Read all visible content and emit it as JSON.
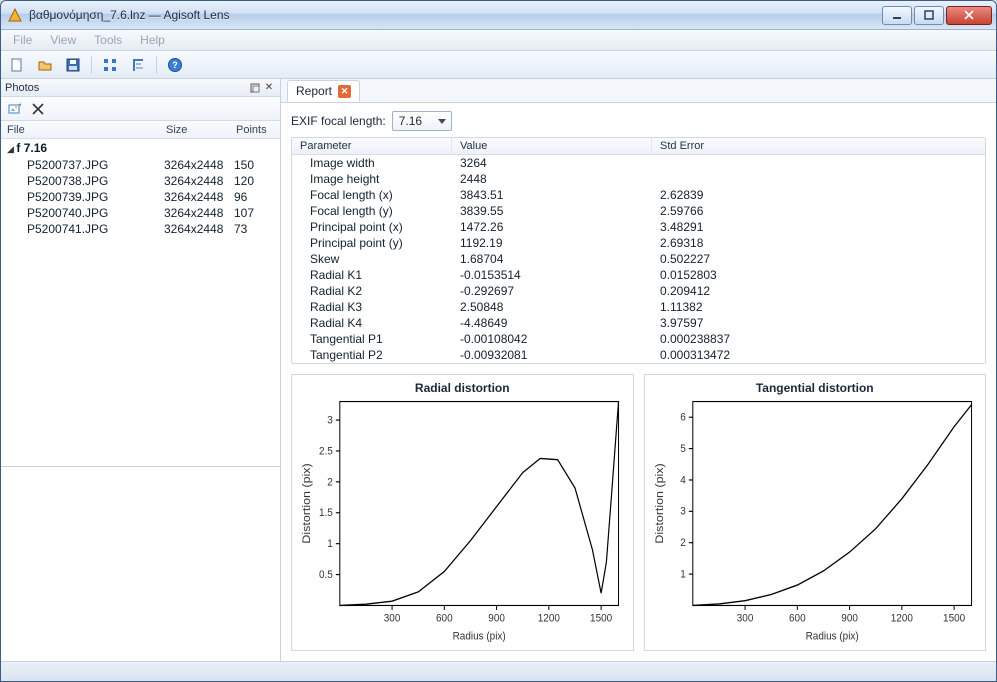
{
  "window": {
    "title": "βαθμονόμηση_7.6.lnz — Agisoft Lens"
  },
  "menu": {
    "file": "File",
    "view": "View",
    "tools": "Tools",
    "help": "Help"
  },
  "photos_panel": {
    "title": "Photos",
    "columns": {
      "file": "File",
      "size": "Size",
      "points": "Points"
    },
    "group_label": "f 7.16",
    "rows": [
      {
        "file": "P5200737.JPG",
        "size": "3264x2448",
        "points": "150"
      },
      {
        "file": "P5200738.JPG",
        "size": "3264x2448",
        "points": "120"
      },
      {
        "file": "P5200739.JPG",
        "size": "3264x2448",
        "points": "96"
      },
      {
        "file": "P5200740.JPG",
        "size": "3264x2448",
        "points": "107"
      },
      {
        "file": "P5200741.JPG",
        "size": "3264x2448",
        "points": "73"
      }
    ]
  },
  "report": {
    "tab_label": "Report",
    "focal_label": "EXIF focal length:",
    "focal_value": "7.16",
    "columns": {
      "parameter": "Parameter",
      "value": "Value",
      "stderr": "Std Error"
    },
    "rows": [
      {
        "param": "Image width",
        "value": "3264",
        "err": ""
      },
      {
        "param": "Image height",
        "value": "2448",
        "err": ""
      },
      {
        "param": "Focal length (x)",
        "value": "3843.51",
        "err": "2.62839"
      },
      {
        "param": "Focal length (y)",
        "value": "3839.55",
        "err": "2.59766"
      },
      {
        "param": "Principal point (x)",
        "value": "1472.26",
        "err": "3.48291"
      },
      {
        "param": "Principal point (y)",
        "value": "1192.19",
        "err": "2.69318"
      },
      {
        "param": "Skew",
        "value": "1.68704",
        "err": "0.502227"
      },
      {
        "param": "Radial K1",
        "value": "-0.0153514",
        "err": "0.0152803"
      },
      {
        "param": "Radial K2",
        "value": "-0.292697",
        "err": "0.209412"
      },
      {
        "param": "Radial K3",
        "value": "2.50848",
        "err": "1.11382"
      },
      {
        "param": "Radial K4",
        "value": "-4.48649",
        "err": "3.97597"
      },
      {
        "param": "Tangential P1",
        "value": "-0.00108042",
        "err": "0.000238837"
      },
      {
        "param": "Tangential P2",
        "value": "-0.00932081",
        "err": "0.000313472"
      }
    ]
  },
  "chart_data": [
    {
      "type": "line",
      "title": "Radial distortion",
      "xlabel": "Radius (pix)",
      "ylabel": "Distortion (pix)",
      "xlim": [
        0,
        1600
      ],
      "ylim": [
        0,
        3.3
      ],
      "xticks": [
        300,
        600,
        900,
        1200,
        1500
      ],
      "yticks": [
        0.5,
        1,
        1.5,
        2,
        2.5,
        3
      ],
      "series": [
        {
          "name": "radial",
          "x": [
            0,
            150,
            300,
            450,
            600,
            750,
            900,
            1050,
            1150,
            1250,
            1350,
            1450,
            1500,
            1530,
            1560,
            1600
          ],
          "values": [
            0.0,
            0.02,
            0.07,
            0.22,
            0.55,
            1.05,
            1.6,
            2.15,
            2.38,
            2.36,
            1.9,
            0.9,
            0.2,
            0.7,
            1.8,
            3.3
          ]
        }
      ]
    },
    {
      "type": "line",
      "title": "Tangential distortion",
      "xlabel": "Radius (pix)",
      "ylabel": "Distortion (pix)",
      "xlim": [
        0,
        1600
      ],
      "ylim": [
        0,
        6.5
      ],
      "xticks": [
        300,
        600,
        900,
        1200,
        1500
      ],
      "yticks": [
        1,
        2,
        3,
        4,
        5,
        6
      ],
      "series": [
        {
          "name": "tangential",
          "x": [
            0,
            150,
            300,
            450,
            600,
            750,
            900,
            1050,
            1200,
            1350,
            1500,
            1600
          ],
          "values": [
            0.0,
            0.05,
            0.15,
            0.35,
            0.65,
            1.1,
            1.7,
            2.45,
            3.4,
            4.5,
            5.7,
            6.4
          ]
        }
      ]
    }
  ]
}
